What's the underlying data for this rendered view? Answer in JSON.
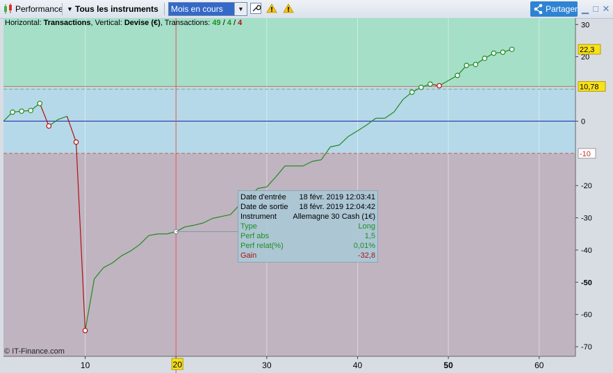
{
  "toolbar": {
    "title": "Performance",
    "instruments_label": "Tous les instruments",
    "period_value": "Mois en cours",
    "share_label": "Partager",
    "icons": [
      "candlestick-icon",
      "dropdown-arrow-icon",
      "wrench-icon",
      "warning-icon",
      "share-icon",
      "minimize-icon",
      "maximize-icon",
      "close-icon"
    ]
  },
  "header": {
    "horizontal_label": "Horizontal:",
    "horizontal_value": "Transactions",
    "vertical_label": "Vertical:",
    "vertical_value": "Devise (€)",
    "transactions_label": "Transactions:",
    "transactions_total": "49",
    "transactions_a": "4",
    "transactions_b": "4",
    "slash": "/"
  },
  "tooltip": {
    "rows": [
      {
        "label": "Date d'entrée",
        "value": "18 févr. 2019 12:03:41",
        "color": "#000000"
      },
      {
        "label": "Date de sortie",
        "value": "18 févr. 2019 12:04:42",
        "color": "#000000"
      },
      {
        "label": "Instrument",
        "value": "Allemagne 30 Cash (1€)",
        "color": "#000000"
      },
      {
        "label": "Type",
        "value": "Long",
        "color": "#1f8f1f"
      },
      {
        "label": "Perf abs",
        "value": "1,5",
        "color": "#1f8f1f"
      },
      {
        "label": "Perf relat(%)",
        "value": "0,01%",
        "color": "#1f8f1f"
      },
      {
        "label": "Gain",
        "value": "-32,8",
        "color": "#b01010"
      }
    ]
  },
  "copyright": "© IT-Finance.com",
  "colors": {
    "zone_top": "#a5dfc8",
    "zone_mid": "#b5d9e8",
    "zone_bottom": "#c0b4c0",
    "gain_line": "#1f8a1f",
    "loss_line": "#b01010",
    "zero_line": "#1a1aa0",
    "cursor_line": "#e05050",
    "level_line": "#d07050"
  },
  "chart_data": {
    "type": "line",
    "x_ticks": [
      10,
      20,
      30,
      40,
      50,
      60
    ],
    "x_range": [
      1,
      64
    ],
    "y_ticks": [
      30,
      20,
      0,
      -20,
      -30,
      -40,
      -50,
      -60,
      -70
    ],
    "y_range": [
      -73,
      32
    ],
    "levels": {
      "upper": 10.78,
      "max": 22.3,
      "lower": -10
    },
    "level_labels": {
      "max": "22,3",
      "upper": "10,78",
      "lower": "-10",
      "zero": "0"
    },
    "cursor_x": 20,
    "cursor_label": "20",
    "highlighted_x_tick": 50,
    "highlighted_y_tick": -50,
    "series": [
      {
        "x": [
          1,
          2,
          3,
          4,
          5,
          6,
          7,
          8,
          9,
          10,
          11,
          12,
          13,
          14,
          15,
          16,
          17,
          18,
          19,
          20,
          21,
          22,
          23,
          24,
          25,
          26,
          27,
          28,
          29,
          30,
          31,
          32,
          33,
          34,
          35,
          36,
          37,
          38,
          39,
          40,
          41,
          42,
          43,
          44,
          45,
          46,
          47,
          48,
          49,
          50,
          51,
          52,
          53,
          54,
          55,
          56,
          57
        ],
        "y": [
          0,
          2.8,
          3.1,
          3.3,
          5.5,
          -1.5,
          0.5,
          1.5,
          -6.5,
          -65,
          -49,
          -45.5,
          -44,
          -41.8,
          -40.3,
          -38.3,
          -35.5,
          -35,
          -35,
          -34.3,
          -32.8,
          -32.3,
          -31.6,
          -30.2,
          -29.6,
          -29,
          -26,
          -23.8,
          -20.9,
          -20.4,
          -17.3,
          -13.9,
          -13.9,
          -13.9,
          -12.5,
          -12,
          -8,
          -7.4,
          -4.7,
          -3,
          -1.2,
          0.9,
          0.9,
          2.8,
          6.7,
          9,
          10.5,
          11.5,
          11,
          12.6,
          14.2,
          17.3,
          17.6,
          19.5,
          21.1,
          21.4,
          22.3
        ],
        "markers": [
          2,
          3,
          4,
          5,
          6,
          9,
          10,
          20,
          46,
          47,
          48,
          49,
          51,
          52,
          53,
          54,
          55,
          56,
          57
        ],
        "loss_segments": [
          [
            5,
            6
          ],
          [
            8,
            9
          ],
          [
            9,
            10
          ],
          [
            48,
            49
          ]
        ]
      }
    ]
  }
}
